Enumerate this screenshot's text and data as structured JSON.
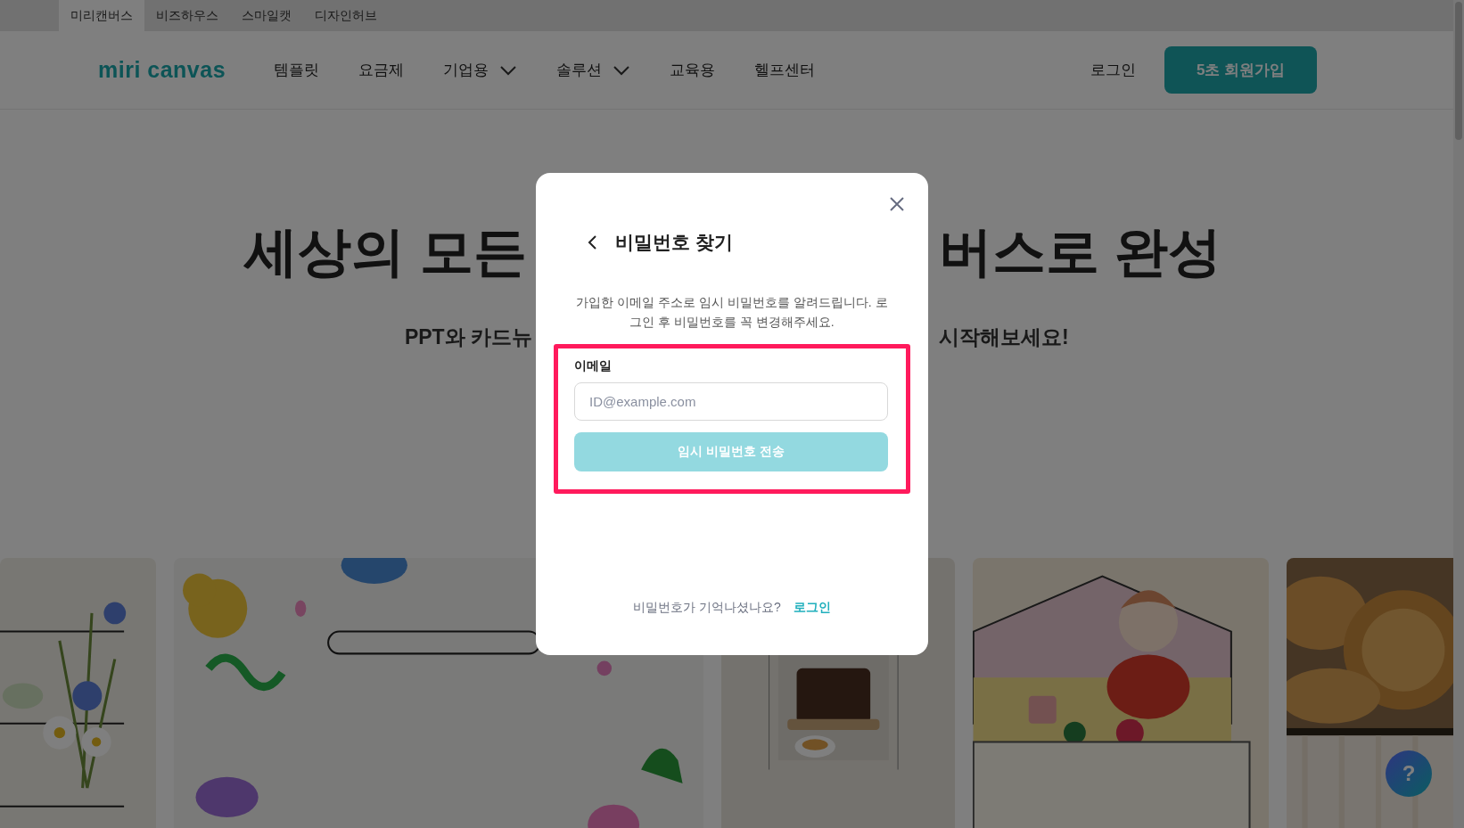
{
  "top_tabs": [
    {
      "label": "미리캔버스",
      "selected": true
    },
    {
      "label": "비즈하우스",
      "selected": false
    },
    {
      "label": "스마일캣",
      "selected": false
    },
    {
      "label": "디자인허브",
      "selected": false
    }
  ],
  "nav": {
    "logo": "miri canvas",
    "items": [
      {
        "label": "템플릿",
        "has_menu": false
      },
      {
        "label": "요금제",
        "has_menu": false
      },
      {
        "label": "기업용",
        "has_menu": true
      },
      {
        "label": "솔루션",
        "has_menu": true
      },
      {
        "label": "교육용",
        "has_menu": false
      },
      {
        "label": "헬프센터",
        "has_menu": false
      }
    ],
    "login": "로그인",
    "signup": "5초 회원가입"
  },
  "hero": {
    "title_left": "세상의 모든",
    "title_right": "버스로 완성",
    "subtitle_left": "PPT와 카드뉴",
    "subtitle_right": "시작해보세요!"
  },
  "modal": {
    "title": "비밀번호 찾기",
    "description": "가입한 이메일 주소로 임시 비밀번호를 알려드립니다. 로그인 후 비밀번호를 꼭 변경해주세요.",
    "highlighted": true,
    "email_label": "이메일",
    "email_placeholder": "ID@example.com",
    "submit": {
      "label": "임시 비밀번호 전송",
      "disabled": true
    },
    "footer_text": "비밀번호가 기억나셨나요?",
    "footer_link": "로그인"
  },
  "help_button": {
    "label": "?"
  }
}
